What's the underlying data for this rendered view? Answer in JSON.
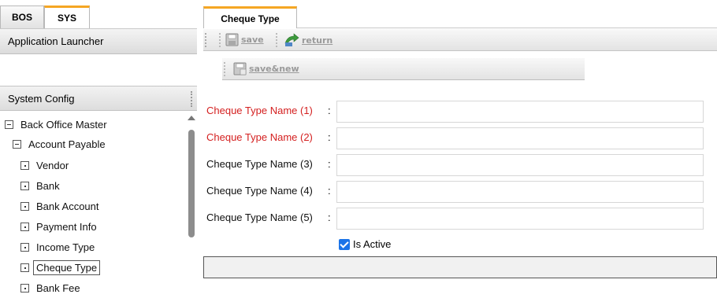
{
  "left_tabs": [
    {
      "label": "BOS",
      "active": false
    },
    {
      "label": "SYS",
      "active": true
    }
  ],
  "app_launcher": "Application Launcher",
  "system_config": "System Config",
  "tree": {
    "root": "Back Office Master",
    "group": "Account Payable",
    "items": [
      "Vendor",
      "Bank",
      "Bank Account",
      "Payment Info",
      "Income Type",
      "Cheque Type",
      "Bank Fee"
    ],
    "selected": "Cheque Type"
  },
  "main_tab": "Cheque Type",
  "toolbar": {
    "save": "save",
    "return": "return",
    "save_new": "save&new"
  },
  "form": {
    "fields": [
      {
        "label": "Cheque Type Name (1)",
        "required": true,
        "value": ""
      },
      {
        "label": "Cheque Type Name (2)",
        "required": true,
        "value": ""
      },
      {
        "label": "Cheque Type Name (3)",
        "required": false,
        "value": ""
      },
      {
        "label": "Cheque Type Name (4)",
        "required": false,
        "value": ""
      },
      {
        "label": "Cheque Type Name (5)",
        "required": false,
        "value": ""
      }
    ],
    "colon": ":",
    "is_active_label": "Is Active",
    "is_active": true
  },
  "colors": {
    "accent_tab": "#f5a623",
    "required_label": "#d42020",
    "checkbox": "#1a73e8"
  }
}
